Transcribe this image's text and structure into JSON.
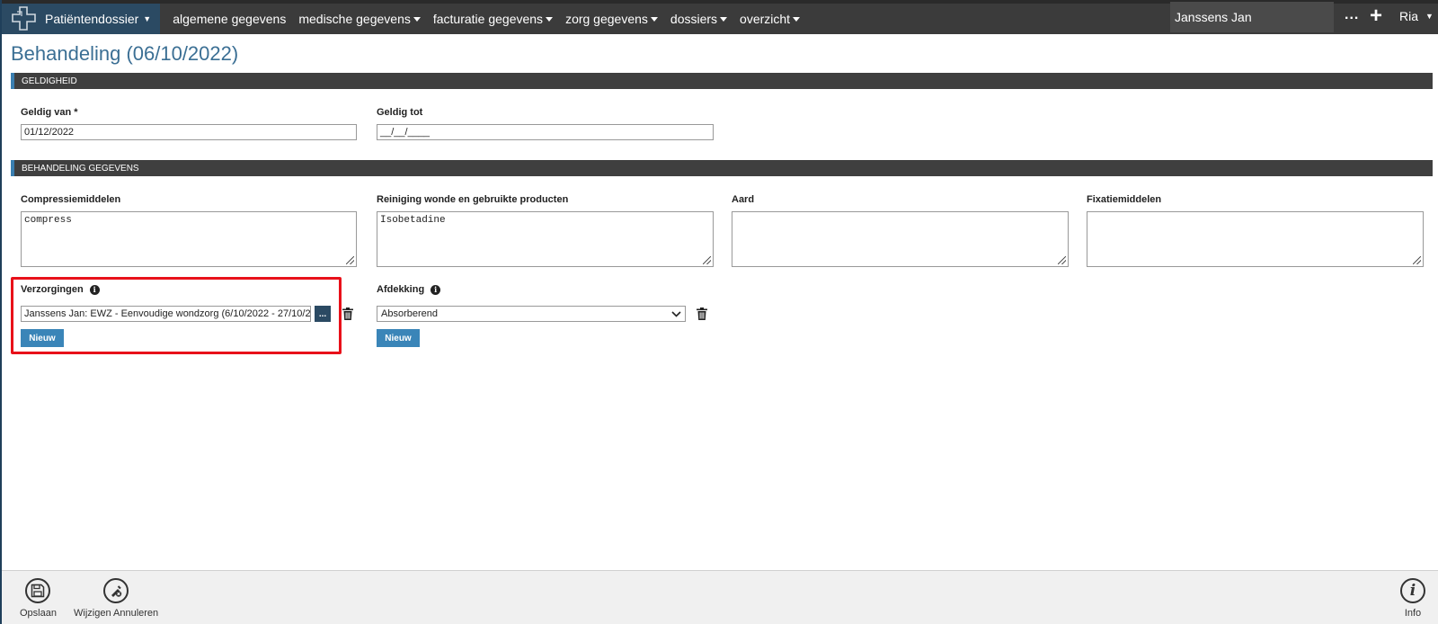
{
  "topbar": {
    "brand_label": "Patiëntendossier",
    "nav": [
      {
        "label": "algemene gegevens",
        "dropdown": false
      },
      {
        "label": "medische gegevens",
        "dropdown": true
      },
      {
        "label": "facturatie gegevens",
        "dropdown": true
      },
      {
        "label": "zorg gegevens",
        "dropdown": true
      },
      {
        "label": "dossiers",
        "dropdown": true
      },
      {
        "label": "overzicht",
        "dropdown": true
      }
    ],
    "patient_name": "Janssens Jan",
    "more_label": "...",
    "add_label": "+",
    "user_label": "Ria"
  },
  "page": {
    "title": "Behandeling (06/10/2022)"
  },
  "sections": {
    "geldigheid": "GELDIGHEID",
    "behandeling": "BEHANDELING GEGEVENS"
  },
  "fields": {
    "geldig_van_label": "Geldig van *",
    "geldig_van_value": "01/12/2022",
    "geldig_tot_label": "Geldig tot",
    "geldig_tot_value": "__/__/____",
    "compressie_label": "Compressiemiddelen",
    "compressie_value": "compress",
    "reiniging_label": "Reiniging wonde en gebruikte producten",
    "reiniging_value": "Isobetadine",
    "aard_label": "Aard",
    "aard_value": "",
    "fixatie_label": "Fixatiemiddelen",
    "fixatie_value": "",
    "verzorgingen_label": "Verzorgingen",
    "verzorgingen_value": "Janssens Jan: EWZ - Eenvoudige wondzorg (6/10/2022 - 27/10/20",
    "verzorgingen_browse": "...",
    "verzorgingen_new": "Nieuw",
    "afdekking_label": "Afdekking",
    "afdekking_value": "Absorberend",
    "afdekking_new": "Nieuw"
  },
  "footer": {
    "save_label": "Opslaan",
    "cancel_label": "Wijzigen Annuleren",
    "info_label": "Info"
  },
  "colors": {
    "accent_blue": "#3a85b8",
    "title_blue": "#3b6f94",
    "highlight_red": "#e8111a",
    "topbar_bg": "#3b3b3b"
  }
}
